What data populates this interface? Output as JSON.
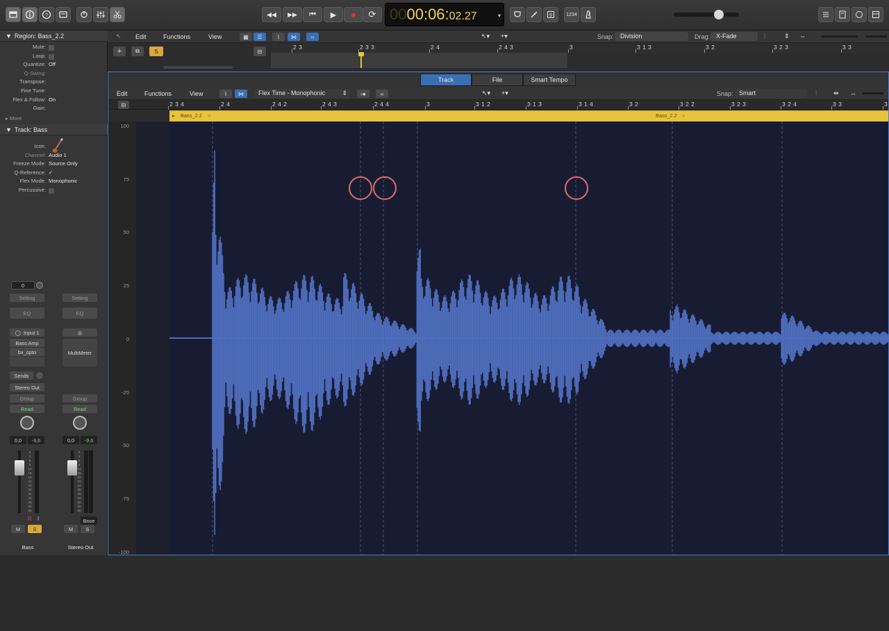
{
  "transport": {
    "time_dim": "00",
    "time_main": "00:06:",
    "time_frac": "02.27",
    "counter": "1234"
  },
  "toolbar": {
    "rewind": "◀◀",
    "forward": "▶▶",
    "tostart": "⏮",
    "play": "▶",
    "record": "●",
    "cycle": "⟳"
  },
  "inspector": {
    "region_title": "Region: Bass_2.2",
    "region_rows": [
      {
        "k": "Mute:",
        "v": ""
      },
      {
        "k": "Loop:",
        "v": ""
      },
      {
        "k": "Quantize:",
        "v": "Off"
      },
      {
        "k": "Q-Swing:",
        "v": ""
      },
      {
        "k": "Transpose:",
        "v": ""
      },
      {
        "k": "Fine Tune:",
        "v": ""
      },
      {
        "k": "Flex & Follow:",
        "v": "On"
      },
      {
        "k": "Gain:",
        "v": ""
      }
    ],
    "more": "More",
    "track_title": "Track:  Bass",
    "track_rows": [
      {
        "k": "Icon:",
        "v": ""
      },
      {
        "k": "Channel:",
        "v": "Audio 1"
      },
      {
        "k": "Freeze Mode:",
        "v": "Source Only"
      },
      {
        "k": "Q-Reference:",
        "v": "✓"
      },
      {
        "k": "Flex Mode:",
        "v": "Monophonic"
      },
      {
        "k": "Percussive:",
        "v": ""
      }
    ]
  },
  "strips": [
    {
      "name": "Bass",
      "setting": "Setting",
      "eq": "EQ",
      "input": "Input 1",
      "plugin1": "Bass Amp",
      "plugin2": "bx_opto",
      "sends": "Sends",
      "output": "Stereo Out",
      "group": "Group",
      "auto": "Read",
      "vol": "0,0",
      "peak": "-9,6",
      "pan_value": "0",
      "m": "M",
      "s": "S"
    },
    {
      "name": "Stereo Out",
      "setting": "Setting",
      "eq": "EQ",
      "plugin1": "MultiMeter",
      "group": "Group",
      "auto": "Read",
      "vol": "0,0",
      "peak": "-9,6",
      "bnce": "Bnce",
      "m": "M",
      "s": "S"
    }
  ],
  "tracks_menu": {
    "edit": "Edit",
    "functions": "Functions",
    "view": "View",
    "snap_label": "Snap:",
    "snap_value": "Division",
    "drag_label": "Drag:",
    "drag_value": "X-Fade"
  },
  "tracks_ruler": [
    "2 3",
    "2 3 3",
    "2 4",
    "2 4 3",
    "3",
    "3 1 3",
    "3 2",
    "3 2 3",
    "3 3"
  ],
  "editor": {
    "tabs": [
      "Track",
      "File",
      "Smart Tempo"
    ],
    "active_tab": "Track",
    "edit": "Edit",
    "functions": "Functions",
    "view": "View",
    "flex_mode": "Flex Time - Monophonic",
    "snap_label": "Snap:",
    "snap_value": "Smart",
    "ruler": [
      "2 3 4",
      "2 4",
      "2 4 2",
      "2 4 3",
      "2 4 4",
      "3",
      "3 1 2",
      "3 1 3",
      "3 1 4",
      "3 2",
      "3 2 2",
      "3 2 3",
      "3 2 4",
      "3 3",
      "3"
    ],
    "region_name_left": "Bass_2.2",
    "region_name_right": "Bass_2.2",
    "y_ticks": [
      "100",
      "75",
      "50",
      "25",
      "0",
      "-25",
      "-50",
      "-75",
      "-100"
    ]
  },
  "colors": {
    "accent": "#3a6fb5",
    "region": "#e9c43b",
    "waveform": "#4f6fbf",
    "marker": "#e06c6c",
    "lcd": "#f1d34d"
  }
}
